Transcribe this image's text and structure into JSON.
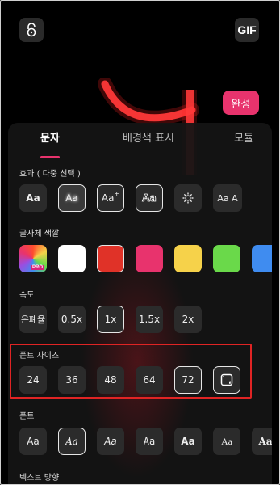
{
  "topbar": {
    "lock_icon": "lock-open-icon",
    "gif_label": "GIF"
  },
  "done_label": "완성",
  "tabs": [
    {
      "label": "문자",
      "active": true
    },
    {
      "label": "배경색 표시",
      "active": false
    },
    {
      "label": "모듈",
      "active": false
    }
  ],
  "effects": {
    "label": "효과 ( 다중 선택 )",
    "items": [
      {
        "label": "Aa"
      },
      {
        "label": "Aa"
      },
      {
        "label": "Aa"
      },
      {
        "label": "Aa"
      },
      {
        "label": ""
      },
      {
        "label": "Aa A"
      }
    ]
  },
  "font_color": {
    "label": "글자체 색깔",
    "pro_badge": "PRO",
    "colors": [
      "#ff4d2e",
      "#ffffff",
      "#e03228",
      "#e8336d",
      "#f6d24a",
      "#6ad94a",
      "#3f8cf0"
    ]
  },
  "speed": {
    "label": "속도",
    "options": [
      "은폐율",
      "0.5x",
      "1x",
      "1.5x",
      "2x"
    ],
    "selected": "1x"
  },
  "font_size": {
    "label": "폰트 사이즈",
    "options": [
      "24",
      "36",
      "48",
      "64",
      "72"
    ],
    "selected": "72"
  },
  "font": {
    "label": "폰트",
    "options": [
      "Aa",
      "Aa",
      "Aa",
      "Aa",
      "Aa",
      "Aa",
      "Aa"
    ]
  },
  "text_direction": {
    "label": "텍스트 방향"
  },
  "accent_color": "#e8336d"
}
